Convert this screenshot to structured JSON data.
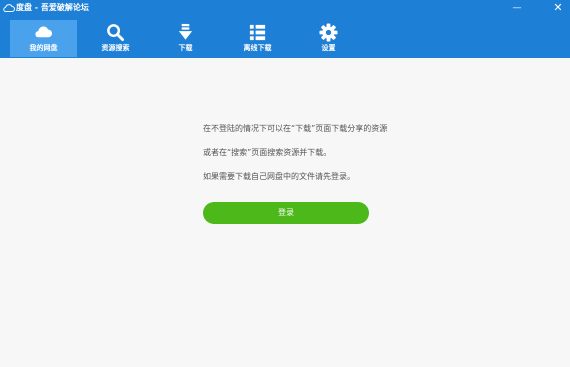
{
  "window": {
    "title": "度盘 - 吾爱破解论坛",
    "min_glyph": "—",
    "close_glyph": "✕"
  },
  "nav": {
    "items": [
      {
        "label": "我的网盘",
        "icon": "cloud-icon",
        "active": true
      },
      {
        "label": "资源搜索",
        "icon": "search-icon",
        "active": false
      },
      {
        "label": "下载",
        "icon": "download-icon",
        "active": false
      },
      {
        "label": "离线下载",
        "icon": "list-icon",
        "active": false
      },
      {
        "label": "设置",
        "icon": "gear-icon",
        "active": false
      }
    ]
  },
  "main": {
    "line1": "在不登陆的情况下可以在“下载”页面下载分享的资源",
    "line2": "或者在“搜索”页面搜索资源并下载。",
    "line3": "如果需要下载自己网盘中的文件请先登录。",
    "login_label": "登录"
  },
  "colors": {
    "header_bg": "#1e7fd6",
    "active_tab": "#4aa2ec",
    "login_button": "#4cb81a"
  }
}
